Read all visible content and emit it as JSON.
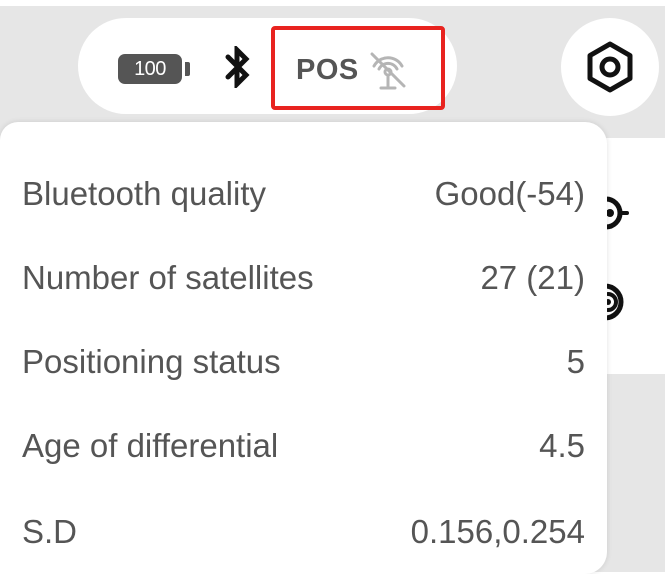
{
  "status_bar": {
    "battery_level": "100",
    "bluetooth_icon": "bluetooth-icon",
    "pos_label": "POS",
    "pos_icon": "no-signal-icon",
    "highlight_color": "#e8231f"
  },
  "settings": {
    "icon": "settings-hexagon-icon"
  },
  "info_rows": [
    {
      "label": "Bluetooth quality",
      "value": "Good(-54)"
    },
    {
      "label": "Number of satellites",
      "value": "27 (21)"
    },
    {
      "label": "Positioning status",
      "value": "5"
    },
    {
      "label": "Age of differential",
      "value": "4.5"
    },
    {
      "label": "S.D",
      "value": "0.156,0.254"
    }
  ],
  "colors": {
    "text": "#555555",
    "background": "#e6e6e6",
    "panel": "#ffffff"
  }
}
